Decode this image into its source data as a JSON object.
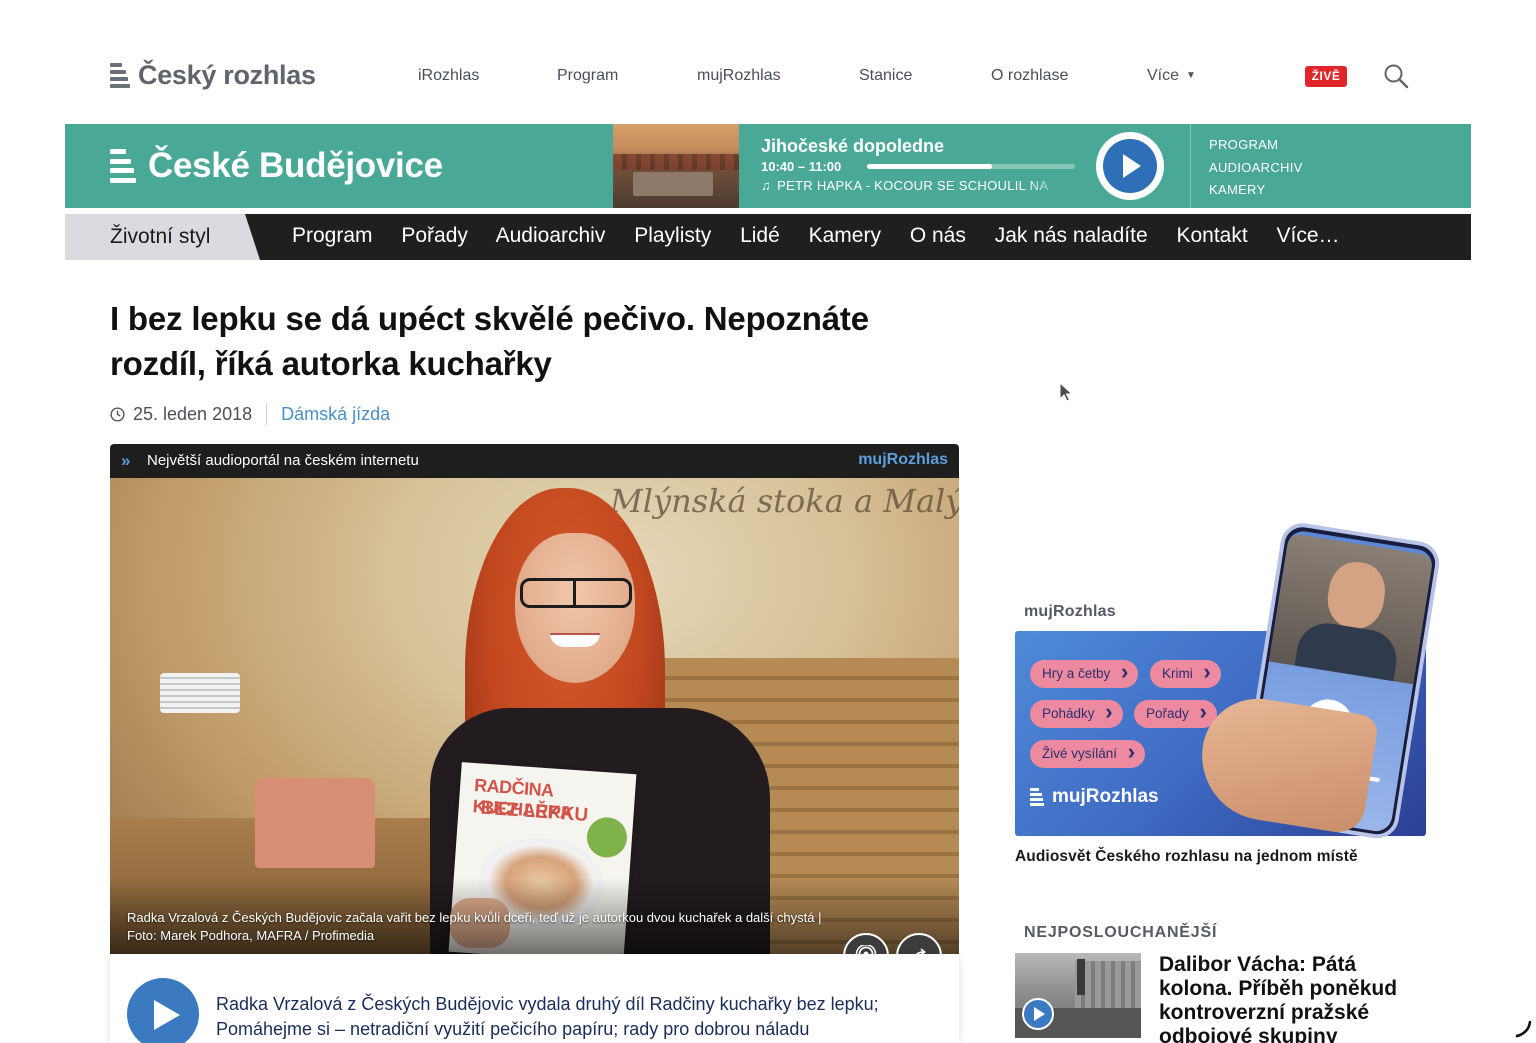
{
  "header": {
    "logo_text": "Český rozhlas",
    "nav": [
      "iRozhlas",
      "Program",
      "mujRozhlas",
      "Stanice",
      "O rozhlase",
      "Více"
    ],
    "live_badge": "ŽIVĚ"
  },
  "station": {
    "name": "České Budějovice",
    "show_title": "Jihočeské dopoledne",
    "show_time": "10:40 – 11:00",
    "progress": 0.6,
    "now_playing": "PETR HAPKA - KOCOUR SE SCHOULIL NA",
    "links": [
      "PROGRAM",
      "AUDIOARCHIV",
      "KAMERY"
    ]
  },
  "section_nav": {
    "label": "Životní styl",
    "items": [
      "Program",
      "Pořady",
      "Audioarchiv",
      "Playlisty",
      "Lidé",
      "Kamery",
      "O nás",
      "Jak nás naladíte",
      "Kontakt",
      "Více…"
    ]
  },
  "article": {
    "headline": "I bez lepku se dá upéct skvělé pečivo. Nepoznáte rozdíl, říká autorka kuchařky",
    "date": "25. leden 2018",
    "category": "Dámská jízda",
    "media_bar_text": "Největší audioportál na českém internetu",
    "media_bar_brand": "mujRozhlas",
    "photo_wall_text": "Mlýnská stoka  a Malý",
    "book_title_line1": "RADČINA KUCHAŘKA",
    "book_title_line2": "BEZ LEPKU",
    "caption": "Radka Vrzalová z Českých Budějovic začala vařit bez lepku kvůli dceři, teď už je autorkou dvou kuchařek a další chystá | Foto: Marek Podhora, MAFRA / Profimedia",
    "audio_title": "Radka Vrzalová z Českých Budějovic vydala druhý díl Radčiny kuchařky bez lepku; Pomáhejme si – netradiční využití pečicího papíru; rady pro dobrou náladu"
  },
  "promo": {
    "label": "mujRozhlas",
    "chips": [
      "Hry a četby",
      "Krimi",
      "Pohádky",
      "Pořady",
      "Živé vysílání"
    ],
    "brand": "mujRozhlas",
    "caption": "Audiosvět Českého rozhlasu na jednom místě"
  },
  "most_listened": {
    "label": "NEJPOSLOUCHANĚJŠÍ",
    "title": "Dalibor Vácha: Pátá kolona. Příběh poněkud kontroverzní pražské odbojové skupiny"
  },
  "colors": {
    "station_green": "#4aa896",
    "live_red": "#e0262b",
    "accent_blue": "#3b7ac0",
    "chip_pink": "#ee8aa0"
  }
}
